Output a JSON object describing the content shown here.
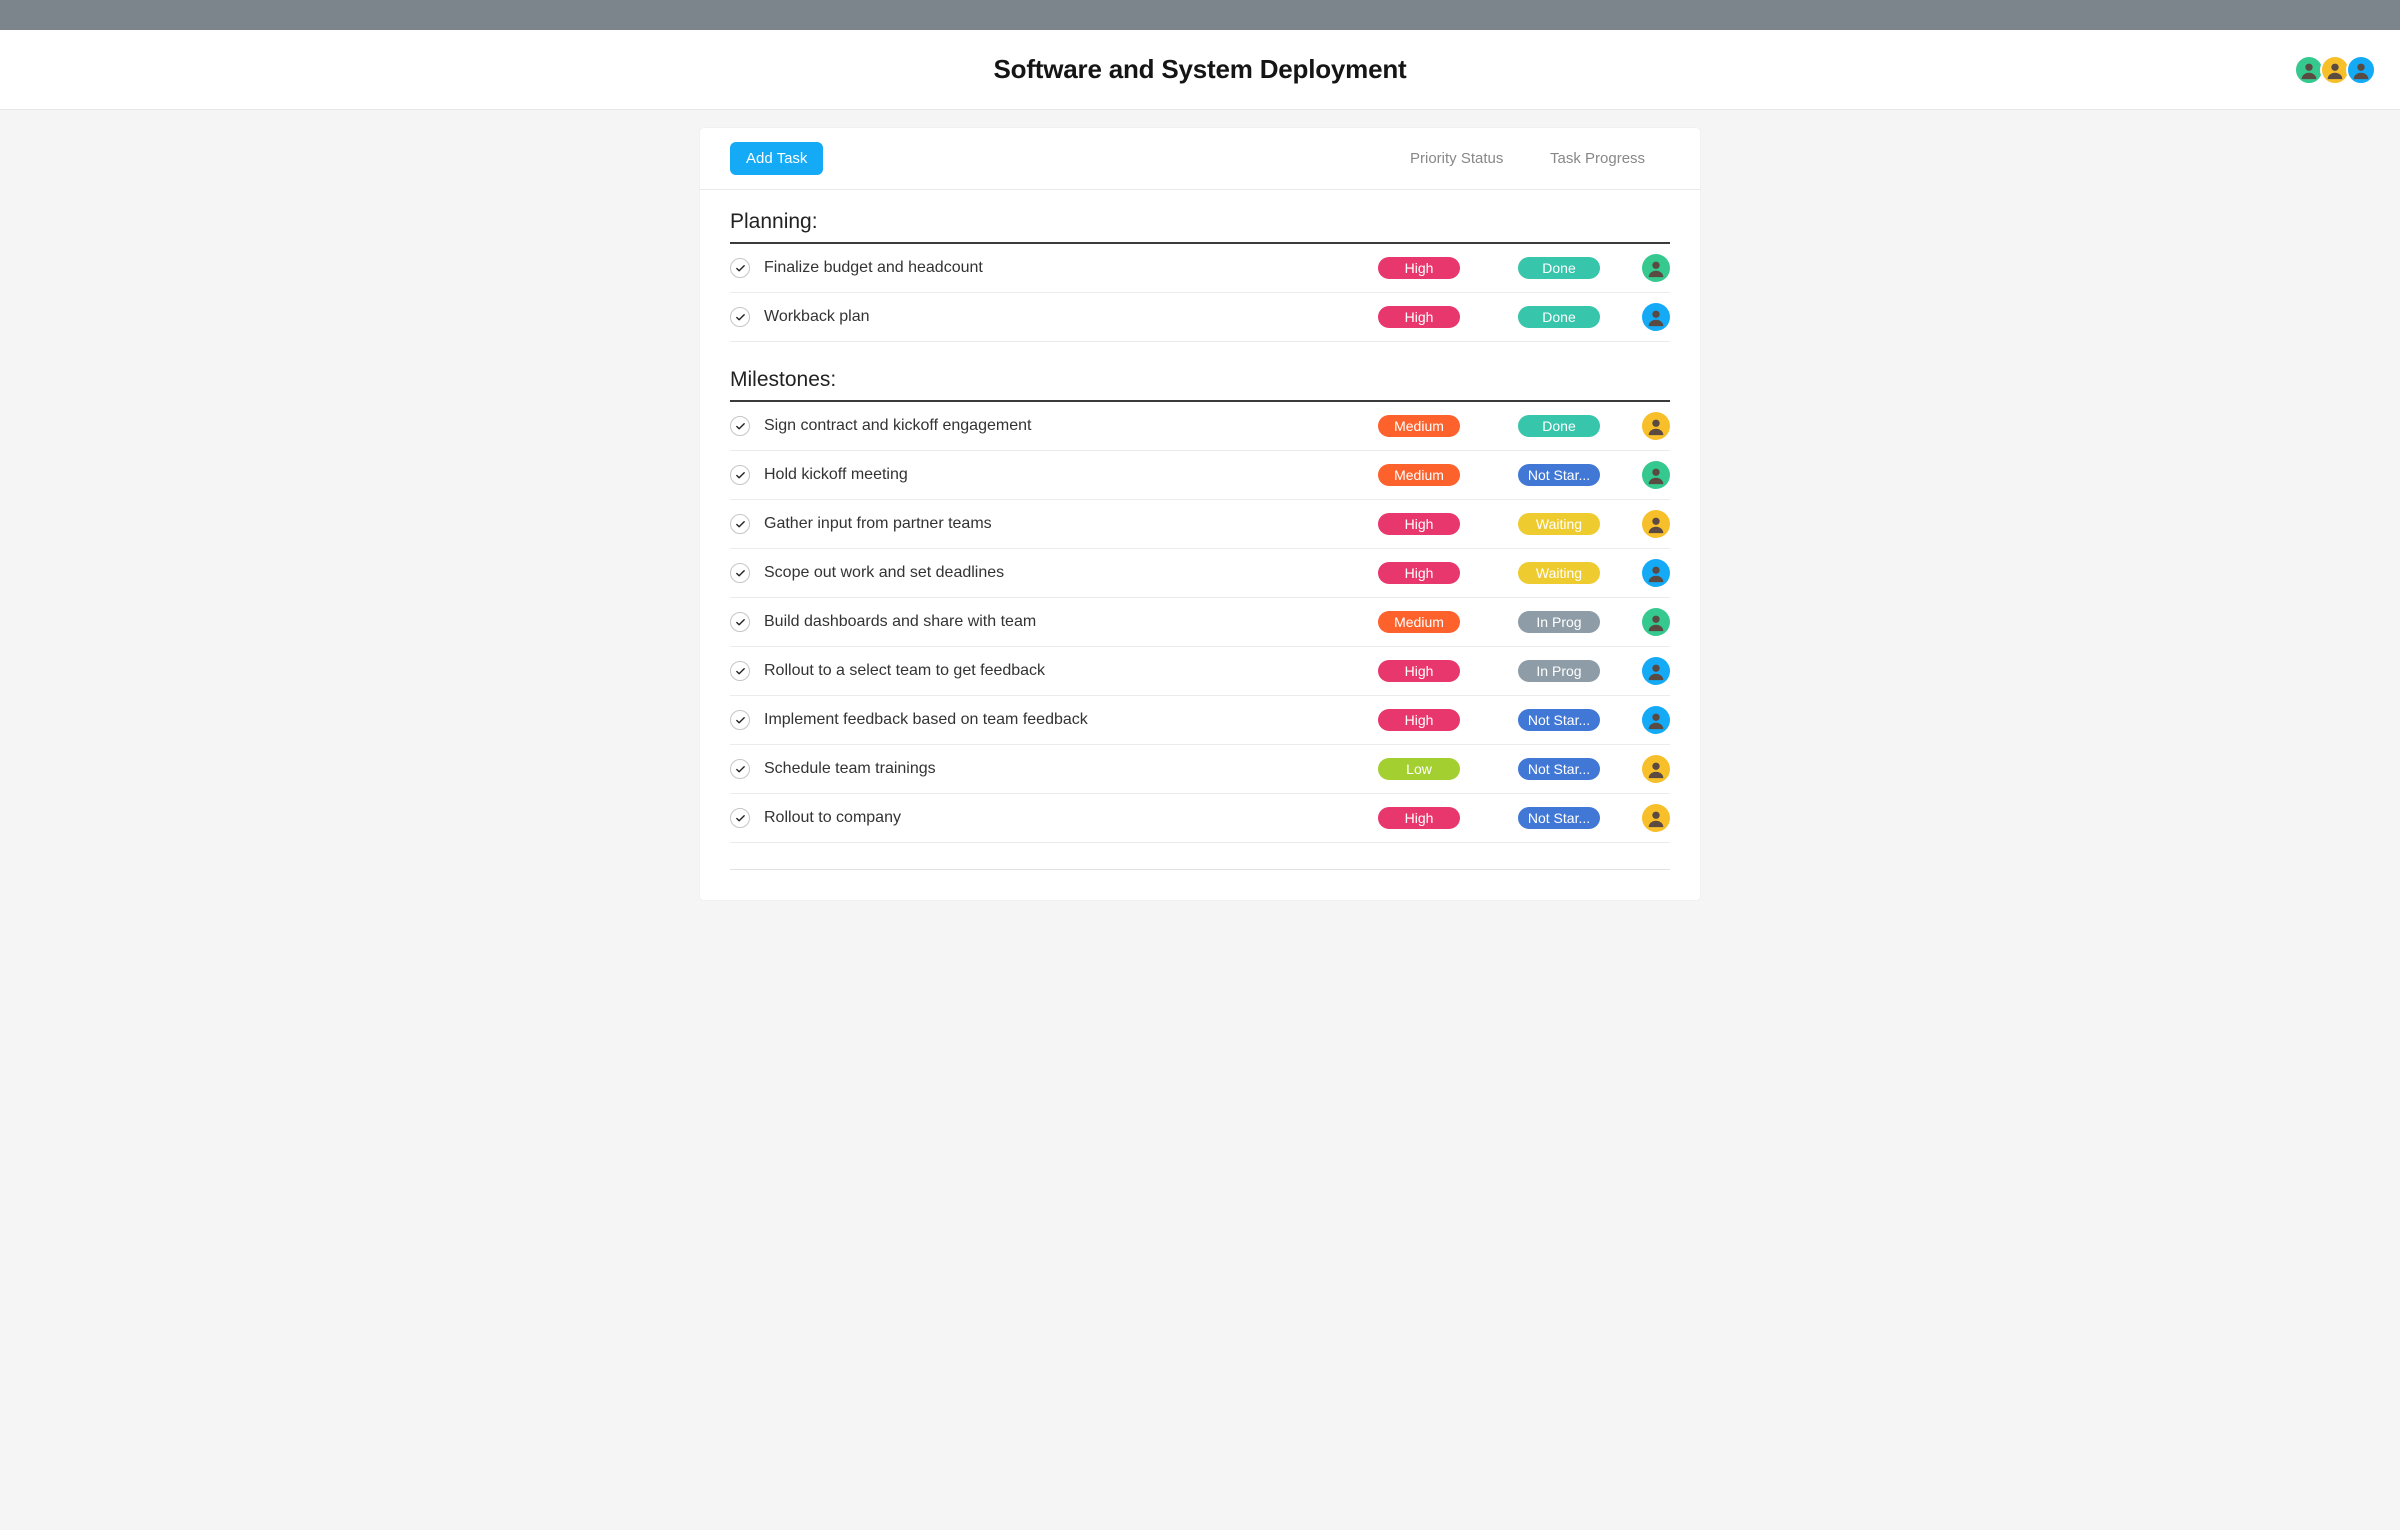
{
  "header": {
    "title": "Software and System Deployment",
    "avatars": [
      "green",
      "yellow",
      "cyan"
    ]
  },
  "toolbar": {
    "add_task_label": "Add Task",
    "col_priority": "Priority Status",
    "col_progress": "Task Progress"
  },
  "colors": {
    "priority": {
      "High": "high",
      "Medium": "medium",
      "Low": "low"
    },
    "progress": {
      "Done": "done",
      "Waiting": "waiting",
      "In Prog": "inprog",
      "Not Star...": "notstart"
    }
  },
  "sections": [
    {
      "title": "Planning:",
      "tasks": [
        {
          "title": "Finalize budget and headcount",
          "priority": "High",
          "progress": "Done",
          "assignee": "green"
        },
        {
          "title": "Workback plan",
          "priority": "High",
          "progress": "Done",
          "assignee": "cyan"
        }
      ]
    },
    {
      "title": "Milestones:",
      "tasks": [
        {
          "title": "Sign contract and kickoff engagement",
          "priority": "Medium",
          "progress": "Done",
          "assignee": "yellow"
        },
        {
          "title": "Hold kickoff meeting",
          "priority": "Medium",
          "progress": "Not Star...",
          "assignee": "green"
        },
        {
          "title": "Gather input from partner teams",
          "priority": "High",
          "progress": "Waiting",
          "assignee": "yellow"
        },
        {
          "title": "Scope out work and set deadlines",
          "priority": "High",
          "progress": "Waiting",
          "assignee": "cyan"
        },
        {
          "title": "Build dashboards and share with team",
          "priority": "Medium",
          "progress": "In Prog",
          "assignee": "green"
        },
        {
          "title": "Rollout to a select team to get feedback",
          "priority": "High",
          "progress": "In Prog",
          "assignee": "cyan"
        },
        {
          "title": "Implement feedback based on team feedback",
          "priority": "High",
          "progress": "Not Star...",
          "assignee": "cyan"
        },
        {
          "title": "Schedule team trainings",
          "priority": "Low",
          "progress": "Not Star...",
          "assignee": "yellow"
        },
        {
          "title": "Rollout to company",
          "priority": "High",
          "progress": "Not Star...",
          "assignee": "yellow"
        }
      ]
    }
  ]
}
